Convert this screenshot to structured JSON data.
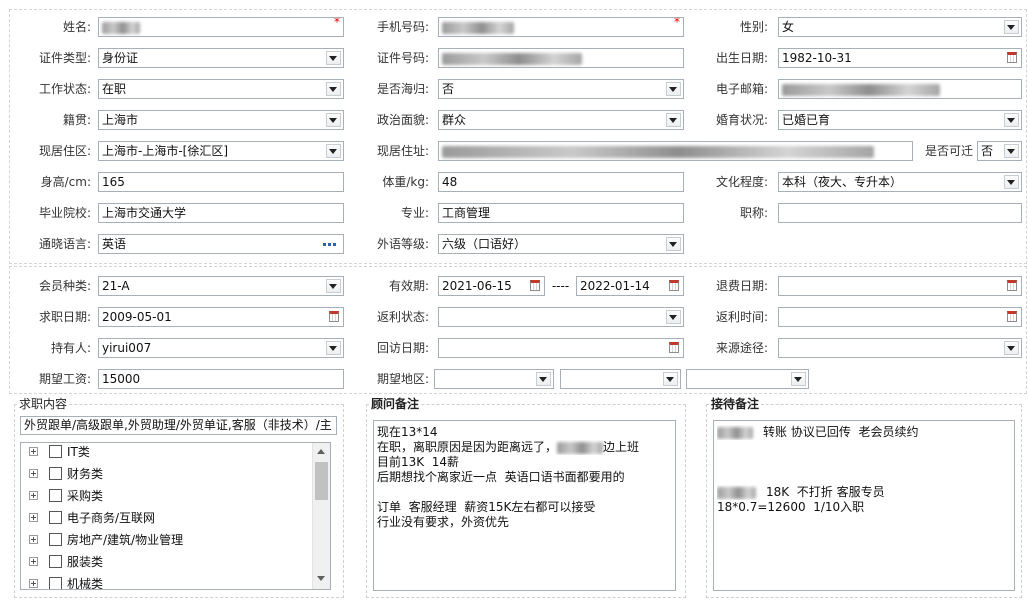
{
  "colors": {
    "required": "#e60000",
    "input_border": "#a7afb9",
    "label": "#333333",
    "text": "#111111",
    "section_border": "#d5d5d5",
    "ellipsis": "#2f5fb3",
    "calendar_accent": "#c0392b"
  },
  "icons": {
    "dropdown": "chevron-down-icon",
    "calendar": "calendar-icon",
    "more": "ellipsis-icon",
    "expand": "plus-square-icon",
    "checkbox": "checkbox-icon"
  },
  "basic": {
    "name": {
      "label": "姓名:",
      "required": "*"
    },
    "mobile": {
      "label": "手机号码:",
      "required": "*"
    },
    "gender": {
      "label": "性别:",
      "value": "女"
    },
    "id_type": {
      "label": "证件类型:",
      "value": "身份证"
    },
    "id_number": {
      "label": "证件号码:"
    },
    "birth_date": {
      "label": "出生日期:",
      "value": "1982-10-31"
    },
    "work_status": {
      "label": "工作状态:",
      "value": "在职"
    },
    "returnee": {
      "label": "是否海归:",
      "value": "否"
    },
    "email": {
      "label": "电子邮箱:"
    },
    "native_place": {
      "label": "籍贯:",
      "value": "上海市"
    },
    "political_status": {
      "label": "政治面貌:",
      "value": "群众"
    },
    "marital_status": {
      "label": "婚育状况:",
      "value": "已婚已育"
    },
    "district": {
      "label": "现居住区:",
      "value": "上海市-上海市-[徐汇区]"
    },
    "address": {
      "label": "现居住址:"
    },
    "relocatable": {
      "label": "是否可迁",
      "value": "否"
    },
    "height": {
      "label": "身高/cm:",
      "value": "165"
    },
    "weight": {
      "label": "体重/kg:",
      "value": "48"
    },
    "education": {
      "label": "文化程度:",
      "value": "本科（夜大、专升本）"
    },
    "school": {
      "label": "毕业院校:",
      "value": "上海市交通大学"
    },
    "major": {
      "label": "专业:",
      "value": "工商管理"
    },
    "job_title": {
      "label": "职称:"
    },
    "languages": {
      "label": "通晓语言:",
      "value": "英语"
    },
    "language_level": {
      "label": "外语等级:",
      "value": "六级（口语好）"
    }
  },
  "membership": {
    "member_type": {
      "label": "会员种类:",
      "value": "21-A"
    },
    "validity": {
      "label": "有效期:",
      "from": "2021-06-15",
      "separator": "----",
      "to": "2022-01-14"
    },
    "refund_date": {
      "label": "退费日期:"
    },
    "apply_date": {
      "label": "求职日期:",
      "value": "2009-05-01"
    },
    "rebate_status": {
      "label": "返利状态:"
    },
    "rebate_time": {
      "label": "返利时间:"
    },
    "holder": {
      "label": "持有人:",
      "value": "yirui007"
    },
    "followup_date": {
      "label": "回访日期:"
    },
    "source": {
      "label": "来源途径:"
    },
    "expected_salary": {
      "label": "期望工资:",
      "value": "15000"
    },
    "expected_area": {
      "label": "期望地区:"
    }
  },
  "job_intent": {
    "legend": "求职内容",
    "selected_text": "外贸跟单/高级跟单,外贸助理/外贸单证,客服（非技术）/主",
    "categories": [
      "IT类",
      "财务类",
      "采购类",
      "电子商务/互联网",
      "房地产/建筑/物业管理",
      "服装类",
      "机械类"
    ]
  },
  "consultant_notes": {
    "legend": "顾问备注",
    "lines": [
      {
        "text": "现在13*14"
      },
      {
        "before": "在职，离职原因是因为距离远了，",
        "after": "边上班"
      },
      {
        "text": "目前13K  14薪"
      },
      {
        "text": "后期想找个离家近一点  英语口语书面都要用的"
      },
      {
        "text": "订单  客服经理  薪资15K左右都可以接受"
      },
      {
        "text": "行业没有要求，外资优先"
      }
    ]
  },
  "reception_notes": {
    "legend": "接待备注",
    "lines": [
      {
        "after": "转账 协议已回传  老会员续约"
      },
      {
        "after": "18K  不打折 客服专员"
      },
      {
        "text": "18*0.7=12600  1/10入职"
      }
    ]
  }
}
